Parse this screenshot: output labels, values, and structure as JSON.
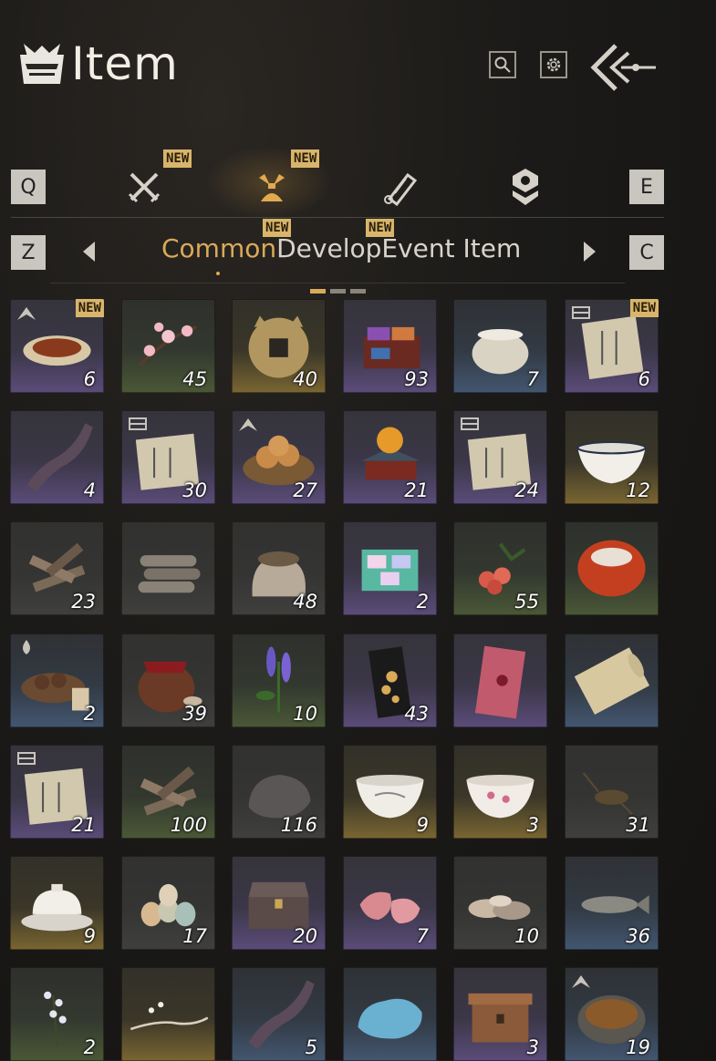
{
  "header": {
    "title": "Item",
    "search_icon": "search-icon",
    "settings_icon": "gear-icon",
    "back_icon": "back-arrow-icon"
  },
  "tabs": {
    "prev_key": "Q",
    "next_key": "E",
    "items": [
      {
        "icon": "crossed-swords-icon",
        "badge": "NEW"
      },
      {
        "icon": "pouch-icon",
        "badge": "NEW",
        "active": true
      },
      {
        "icon": "scroll-icon",
        "badge": ""
      },
      {
        "icon": "layers-icon",
        "badge": ""
      }
    ]
  },
  "subtabs": {
    "prev_key": "Z",
    "next_key": "C",
    "items": [
      {
        "label": "Common",
        "badge": "",
        "active": true
      },
      {
        "label": "Develop",
        "badge": "NEW"
      },
      {
        "label": "Event Item",
        "badge": "NEW"
      }
    ]
  },
  "colors": {
    "accent": "#d9aa58",
    "badge": "#d8b56b",
    "bg": "#1b1a18"
  },
  "items": [
    {
      "name": "fish-dish",
      "qty": "6",
      "tier": "purple",
      "badge": "NEW",
      "mark": "up"
    },
    {
      "name": "plum-blossom",
      "qty": "45",
      "tier": "green"
    },
    {
      "name": "coin",
      "qty": "40",
      "tier": "gold"
    },
    {
      "name": "pigment-box",
      "qty": "93",
      "tier": "purple"
    },
    {
      "name": "porcelain-jar",
      "qty": "7",
      "tier": "blue"
    },
    {
      "name": "manual-scroll",
      "qty": "6",
      "tier": "purple",
      "badge": "NEW",
      "mark": "book"
    },
    {
      "name": "horn",
      "qty": "4",
      "tier": "purple"
    },
    {
      "name": "manual-page",
      "qty": "30",
      "tier": "purple",
      "mark": "book"
    },
    {
      "name": "bread-basket",
      "qty": "27",
      "tier": "purple",
      "mark": "up"
    },
    {
      "name": "orb-stand",
      "qty": "21",
      "tier": "purple"
    },
    {
      "name": "manual-page",
      "qty": "24",
      "tier": "purple",
      "mark": "book"
    },
    {
      "name": "white-bowl",
      "qty": "12",
      "tier": "gold"
    },
    {
      "name": "firewood",
      "qty": "23",
      "tier": "gray"
    },
    {
      "name": "logs",
      "qty": "",
      "tier": "gray"
    },
    {
      "name": "grain-sack",
      "qty": "48",
      "tier": "gray"
    },
    {
      "name": "gem-box",
      "qty": "2",
      "tier": "purple"
    },
    {
      "name": "lychee",
      "qty": "55",
      "tier": "green"
    },
    {
      "name": "red-stone",
      "qty": "",
      "tier": "green"
    },
    {
      "name": "pills",
      "qty": "2",
      "tier": "blue",
      "mark": "drop"
    },
    {
      "name": "wine-jar",
      "qty": "39",
      "tier": "gray"
    },
    {
      "name": "lavender",
      "qty": "10",
      "tier": "green"
    },
    {
      "name": "gold-card",
      "qty": "43",
      "tier": "purple"
    },
    {
      "name": "red-envelope",
      "qty": "",
      "tier": "purple"
    },
    {
      "name": "paper-scroll",
      "qty": "",
      "tier": "blue"
    },
    {
      "name": "manual-page",
      "qty": "21",
      "tier": "purple",
      "mark": "book"
    },
    {
      "name": "firewood",
      "qty": "100",
      "tier": "green"
    },
    {
      "name": "rock",
      "qty": "116",
      "tier": "gray"
    },
    {
      "name": "painted-bowl",
      "qty": "9",
      "tier": "gold"
    },
    {
      "name": "flower-bowl",
      "qty": "3",
      "tier": "gold"
    },
    {
      "name": "cricket",
      "qty": "31",
      "tier": "gray"
    },
    {
      "name": "lidded-bowl",
      "qty": "9",
      "tier": "gold"
    },
    {
      "name": "eggs",
      "qty": "17",
      "tier": "gray"
    },
    {
      "name": "treasure-chest",
      "qty": "20",
      "tier": "purple"
    },
    {
      "name": "raw-meat",
      "qty": "7",
      "tier": "purple"
    },
    {
      "name": "oysters",
      "qty": "10",
      "tier": "gray"
    },
    {
      "name": "fish",
      "qty": "36",
      "tier": "blue"
    },
    {
      "name": "white-flowers",
      "qty": "2",
      "tier": "green"
    },
    {
      "name": "branch",
      "qty": "",
      "tier": "gold"
    },
    {
      "name": "horn",
      "qty": "5",
      "tier": "blue"
    },
    {
      "name": "blue-ore",
      "qty": "",
      "tier": "blue"
    },
    {
      "name": "carved-box",
      "qty": "3",
      "tier": "purple"
    },
    {
      "name": "stew-pot",
      "qty": "19",
      "tier": "blue",
      "mark": "up"
    }
  ]
}
